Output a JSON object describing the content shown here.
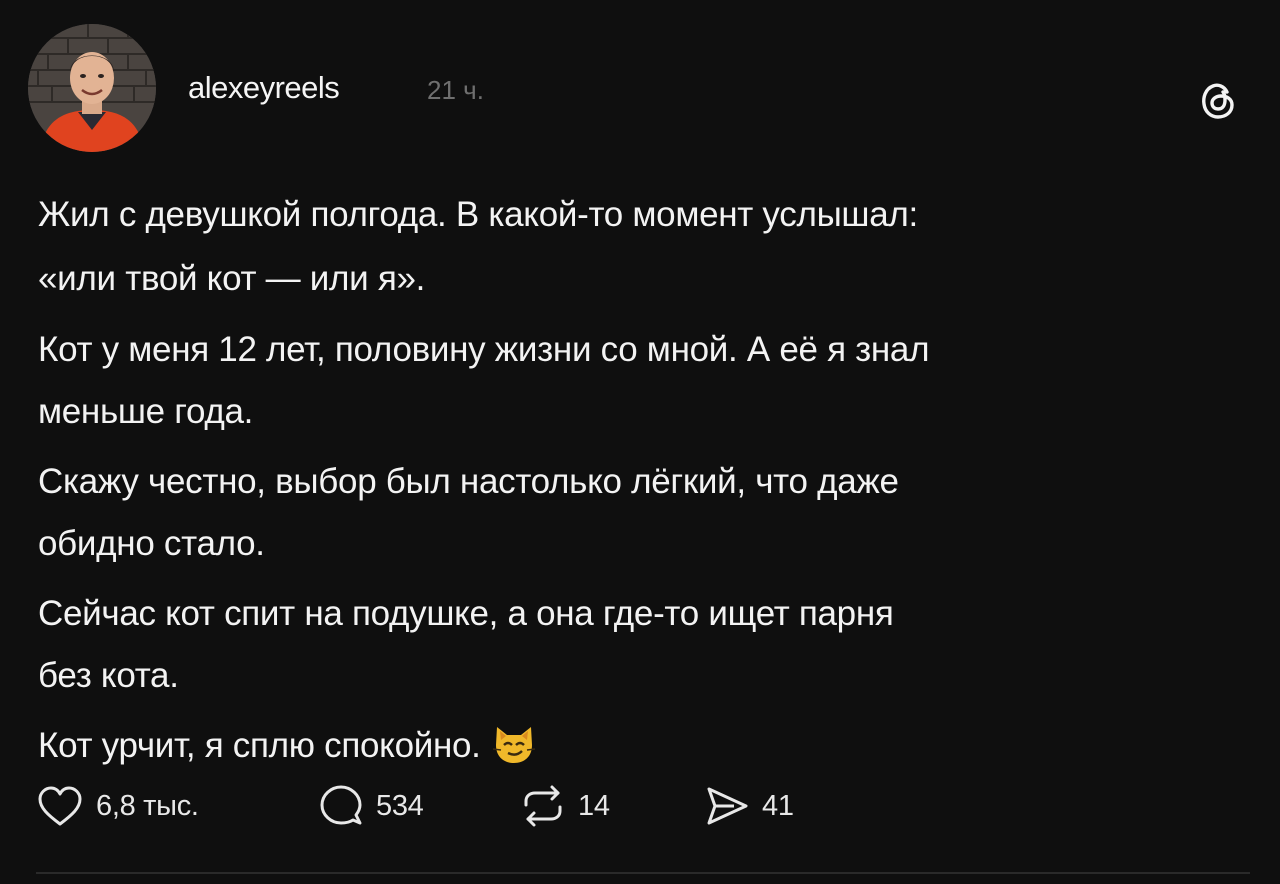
{
  "post": {
    "username": "alexeyreels",
    "timestamp": "21 ч.",
    "avatar_icon": "profile-photo",
    "app_logo_icon": "threads-logo-icon",
    "paragraphs": [
      "Жил с девушкой полгода. В какой-то момент услышал:\n«или твой кот — или я».",
      "Кот у меня 12 лет, половину жизни со мной. А её я знал\nменьше года.",
      "Скажу честно, выбор был настолько лёгкий, что даже\nобидно стало.",
      "Сейчас кот спит на подушке, а она где-то ищет парня\nбез кота.",
      "Кот урчит, я сплю спокойно."
    ],
    "ending_emoji": "smirking-cat-emoji"
  },
  "actions": {
    "like_count": "6,8 тыс.",
    "reply_count": "534",
    "repost_count": "14",
    "share_count": "41"
  },
  "colors": {
    "background": "#0f0f0f",
    "text": "#f3f3f3",
    "muted": "#6f6f6f"
  }
}
